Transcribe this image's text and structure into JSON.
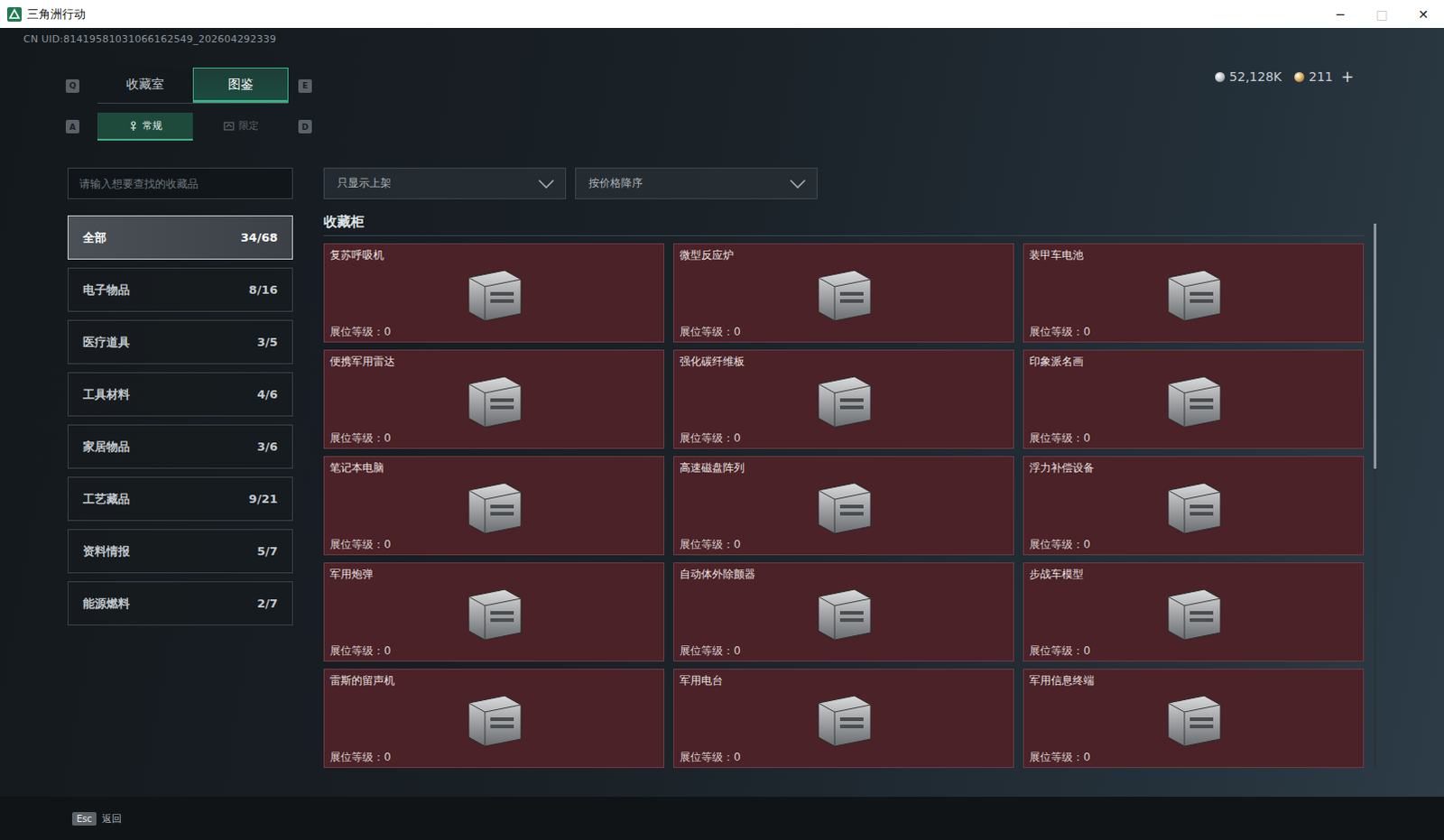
{
  "window": {
    "title": "三角洲行动",
    "controls": [
      {
        "glyph": "─",
        "disabled": false
      },
      {
        "glyph": "□",
        "disabled": true
      },
      {
        "glyph": "✕",
        "disabled": false
      }
    ]
  },
  "uid": "CN UID:81419581031066162549_202604292339",
  "tabs": {
    "prev_key": "Q",
    "next_key": "E",
    "items": [
      {
        "label": "收藏室",
        "selected": false
      },
      {
        "label": "图鉴",
        "selected": true
      }
    ]
  },
  "sub_tabs": {
    "prev_key": "A",
    "next_key": "D",
    "items": [
      {
        "label": "常规",
        "selected": true
      },
      {
        "label": "限定",
        "selected": false
      }
    ]
  },
  "currency": [
    {
      "amount": "52,128K",
      "color": "#b9bec3",
      "add": ""
    },
    {
      "amount": "211",
      "color": "#d6a04a",
      "add": "+"
    }
  ],
  "search": {
    "placeholder": "请输入想要查找的收藏品"
  },
  "filters": [
    {
      "value": "只显示上架"
    },
    {
      "value": "按价格降序"
    }
  ],
  "categories": [
    {
      "name": "全部",
      "count": "34/68",
      "selected": true
    },
    {
      "name": "电子物品",
      "count": "8/16",
      "selected": false
    },
    {
      "name": "医疗道具",
      "count": "3/5",
      "selected": false
    },
    {
      "name": "工具材料",
      "count": "4/6",
      "selected": false
    },
    {
      "name": "家居物品",
      "count": "3/6",
      "selected": false
    },
    {
      "name": "工艺藏品",
      "count": "9/21",
      "selected": false
    },
    {
      "name": "资料情报",
      "count": "5/7",
      "selected": false
    },
    {
      "name": "能源燃料",
      "count": "2/7",
      "selected": false
    }
  ],
  "section_title": "收藏柜",
  "level_label": "展位等级：",
  "items": [
    {
      "name": "复苏呼吸机",
      "level": "0"
    },
    {
      "name": "微型反应炉",
      "level": "0"
    },
    {
      "name": "装甲车电池",
      "level": "0"
    },
    {
      "name": "便携军用雷达",
      "level": "0"
    },
    {
      "name": "强化碳纤维板",
      "level": "0"
    },
    {
      "name": "印象派名画",
      "level": "0"
    },
    {
      "name": "笔记本电脑",
      "level": "0"
    },
    {
      "name": "高速磁盘阵列",
      "level": "0"
    },
    {
      "name": "浮力补偿设备",
      "level": "0"
    },
    {
      "name": "军用炮弹",
      "level": "0"
    },
    {
      "name": "自动体外除颤器",
      "level": "0"
    },
    {
      "name": "步战车模型",
      "level": "0"
    },
    {
      "name": "雷斯的留声机",
      "level": "0"
    },
    {
      "name": "军用电台",
      "level": "0"
    },
    {
      "name": "军用信息终端",
      "level": "0"
    }
  ],
  "scrollbar": {
    "level": 0.45
  },
  "footer": {
    "key": "Esc",
    "label": "返回"
  }
}
